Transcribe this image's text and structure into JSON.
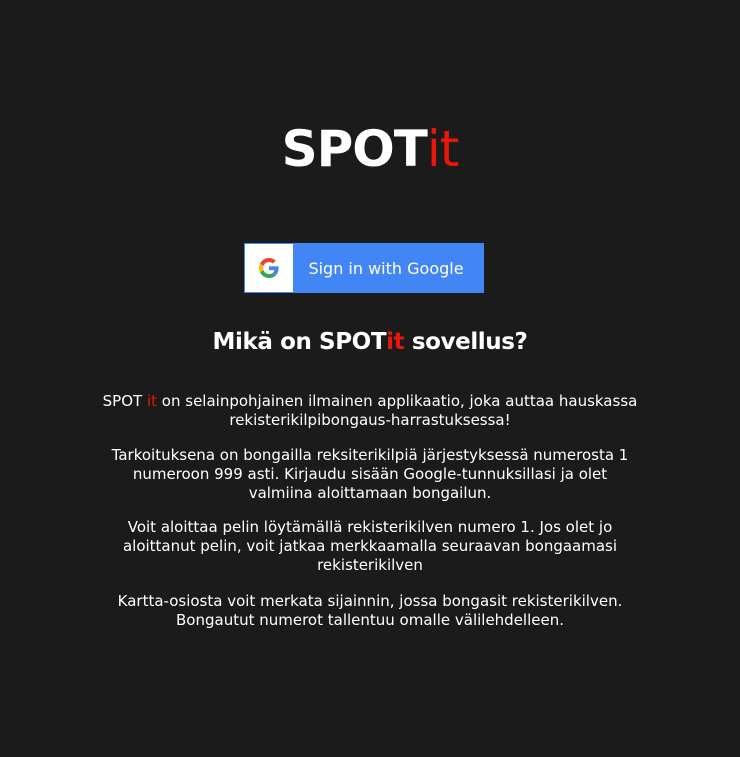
{
  "logo": {
    "spot": "SPOT",
    "it": "it"
  },
  "signin": {
    "label": "Sign in with Google",
    "icon": "google-g-icon"
  },
  "heading": {
    "before": "Mikä on SPOT",
    "it": "it",
    "after": " sovellus?"
  },
  "paragraphs": {
    "p1": {
      "spot": "SPOT ",
      "it": "it",
      "rest": " on selainpohjainen ilmainen applikaatio, joka auttaa hauskassa rekisterikilpibongaus-harrastuksessa!"
    },
    "p2": "Tarkoituksena on bongailla reksiterikilpiä järjestyksessä numerosta 1 numeroon 999 asti. Kirjaudu sisään Google-tunnuksillasi ja olet valmiina aloittamaan bongailun.",
    "p3": "Voit aloittaa pelin löytämällä rekisterikilven numero 1. Jos olet jo aloittanut pelin, voit jatkaa merkkaamalla seuraavan bongaamasi rekisterikilven",
    "p4": "Kartta-osiosta voit merkata sijainnin, jossa bongasit rekisterikilven. Bongautut numerot tallentuu omalle välilehdelleen."
  },
  "colors": {
    "background": "#1b1b1b",
    "accent": "#e8170c",
    "google_blue": "#4285f4"
  }
}
